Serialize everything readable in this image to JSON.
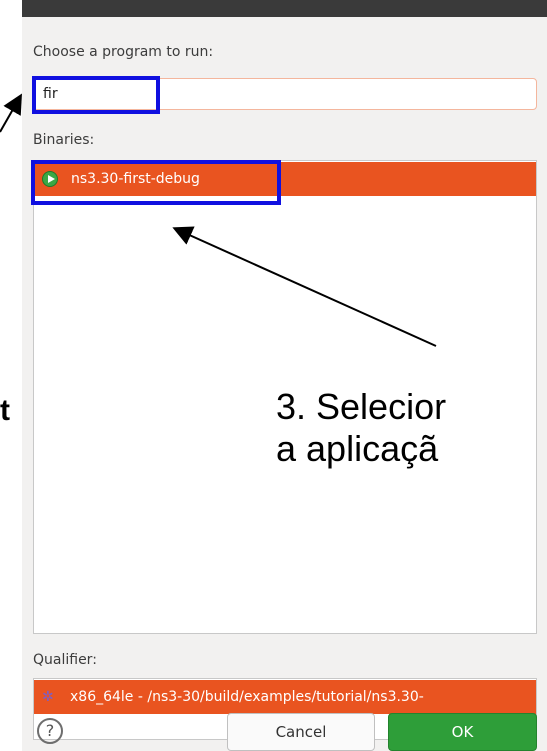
{
  "dialog": {
    "prompt_label": "Choose a program to run:",
    "filter_value": "fir",
    "binaries_label": "Binaries:",
    "binaries": [
      {
        "name": "ns3.30-first-debug",
        "selected": true,
        "icon": "run-icon"
      }
    ],
    "qualifier_label": "Qualifier:",
    "qualifiers": [
      {
        "path": "x86_64le - /ns3-30/build/examples/tutorial/ns3.30-",
        "selected": true,
        "icon": "bug-icon"
      }
    ],
    "buttons": {
      "help": "?",
      "cancel": "Cancel",
      "ok": "OK"
    },
    "accent_color": "#e95420",
    "ok_color": "#2e9e39"
  },
  "annotation": {
    "step_text_line1": "3. Selecior",
    "step_text_line2": "a aplicaçã",
    "left_fragment": "t",
    "highlight_color": "#1010e0"
  }
}
